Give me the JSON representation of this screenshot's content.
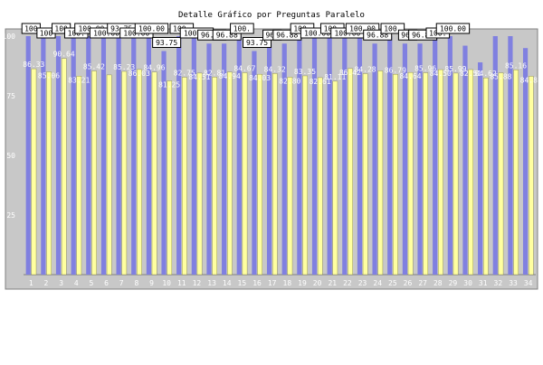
{
  "chart_data": {
    "type": "bar",
    "title": "Detalle Gráfico por Preguntas Paralelo",
    "xlabel": "",
    "ylabel": "",
    "ylim": [
      0,
      100
    ],
    "yticks": [
      25,
      50,
      75,
      100
    ],
    "grid": false,
    "legend": "none",
    "categories": [
      "1",
      "2",
      "3",
      "4",
      "5",
      "6",
      "7",
      "8",
      "9",
      "10",
      "11",
      "12",
      "13",
      "14",
      "15",
      "16",
      "17",
      "18",
      "19",
      "20",
      "21",
      "22",
      "23",
      "24",
      "25",
      "26",
      "27",
      "28",
      "29",
      "30",
      "31",
      "32",
      "33",
      "34"
    ],
    "series": [
      {
        "color": "#8080e0",
        "values": [
          100,
          100,
          100,
          100,
          100,
          100,
          100,
          100,
          100,
          93.75,
          100,
          100,
          96.88,
          96.88,
          100,
          93.75,
          96.88,
          96.88,
          100,
          100,
          100,
          100,
          100,
          96.88,
          100,
          96.88,
          96.88,
          100,
          100,
          96,
          89,
          100,
          100,
          95
        ],
        "labels": [
          "100",
          "100",
          "100",
          "100.",
          "100.00",
          "100.00",
          "93.75",
          "100.00",
          "100.00",
          "93.75",
          "100.",
          "100.00",
          "96.88",
          "96.88",
          "100.",
          "93.75",
          "96.",
          "96.88",
          "100.",
          "100.00",
          "100.",
          "100.00",
          "100.00",
          "96.88",
          "100.",
          "96.",
          "96.88",
          "100.",
          "100.00",
          "",
          "",
          "",
          "",
          ""
        ]
      },
      {
        "color": "#ffffa0",
        "values": [
          86.33,
          85.06,
          90.64,
          83.21,
          85.42,
          83.75,
          85.23,
          86.03,
          84.96,
          81.25,
          82.75,
          84.51,
          82.81,
          84.94,
          84.67,
          84.03,
          84.32,
          82.8,
          83.35,
          82.61,
          81.11,
          86.42,
          84.28,
          85.43,
          83.99,
          84.79,
          84.64,
          85.96,
          84.5,
          85.99,
          82.51,
          84.62,
          85.88,
          83.16
        ],
        "labels": [
          "86.33",
          "85.06",
          "90.64",
          "83.21",
          "85.42",
          "",
          "85.23",
          "86.03",
          "84.96",
          "81.25",
          "82.75",
          "84.51",
          "82.81",
          "84.94",
          "84.67",
          "84.03",
          "84.32",
          "82.80",
          "83.35",
          "82.61",
          "81.11",
          "86.42",
          "84.28",
          "",
          "86.79",
          "84.64",
          "85.96",
          "84.50",
          "85.99",
          "82.51",
          "84.62",
          "85.88",
          "85.16",
          "84.88"
        ]
      }
    ]
  }
}
